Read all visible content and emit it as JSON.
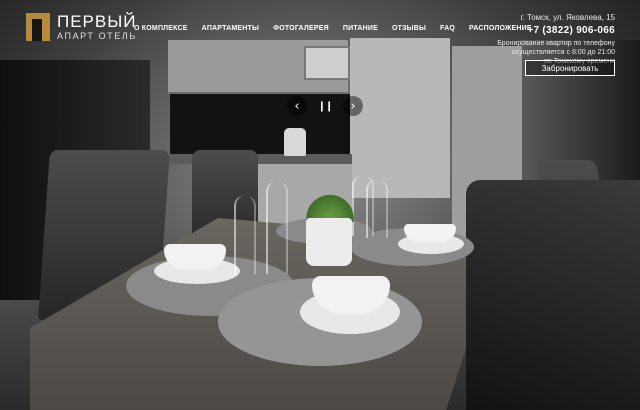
{
  "brand": {
    "title": "ПЕРВЫЙ",
    "subtitle": "АПАРТ ОТЕЛЬ",
    "logo_icon": "hotel-logo-icon",
    "accent_color": "#b58a3c"
  },
  "nav": {
    "items": [
      {
        "label": "О КОМПЛЕКСЕ"
      },
      {
        "label": "АПАРТАМЕНТЫ"
      },
      {
        "label": "ФОТОГАЛЕРЕЯ"
      },
      {
        "label": "ПИТАНИЕ"
      },
      {
        "label": "ОТЗЫВЫ"
      },
      {
        "label": "FAQ"
      },
      {
        "label": "РАСПОЛОЖЕНИЕ"
      }
    ]
  },
  "contact": {
    "address": "г. Томск, ул. Яковлева, 15",
    "phone": "+7 (3822) 906-066",
    "booking_note_line1": "Бронирование квартир по телефону",
    "booking_note_line2": "осуществляется с 8:00 до 21:00",
    "booking_note_line3": "по Томскому времени",
    "book_button": "Забронировать"
  },
  "slider": {
    "prev_icon": "chevron-left-icon",
    "pause_icon": "pause-icon",
    "next_icon": "chevron-right-icon",
    "prev_glyph": "‹",
    "pause_glyph": "❙❙",
    "next_glyph": "›"
  }
}
